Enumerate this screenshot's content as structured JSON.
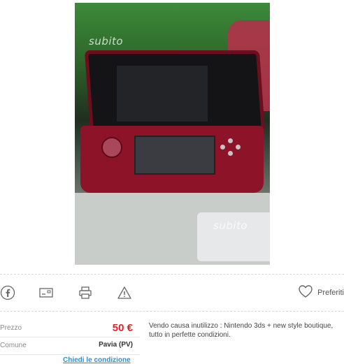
{
  "listing": {
    "watermark": "subito",
    "description": "Vendo causa inutilizzo : Nintendo 3ds + new style boutique, tutto in perfette condizioni."
  },
  "actions": {
    "share_icons": [
      "facebook-icon",
      "email-icon",
      "print-icon",
      "warning-icon"
    ],
    "favorite_label": "Preferiti"
  },
  "details": {
    "rows": [
      {
        "label": "Prezzo",
        "value": "50 €"
      },
      {
        "label": "Comune",
        "value": "Pavia (PV)"
      }
    ],
    "cta": "Chiedi le condizione"
  },
  "colors": {
    "price": "#e31e2f",
    "link": "#2a90d6"
  }
}
